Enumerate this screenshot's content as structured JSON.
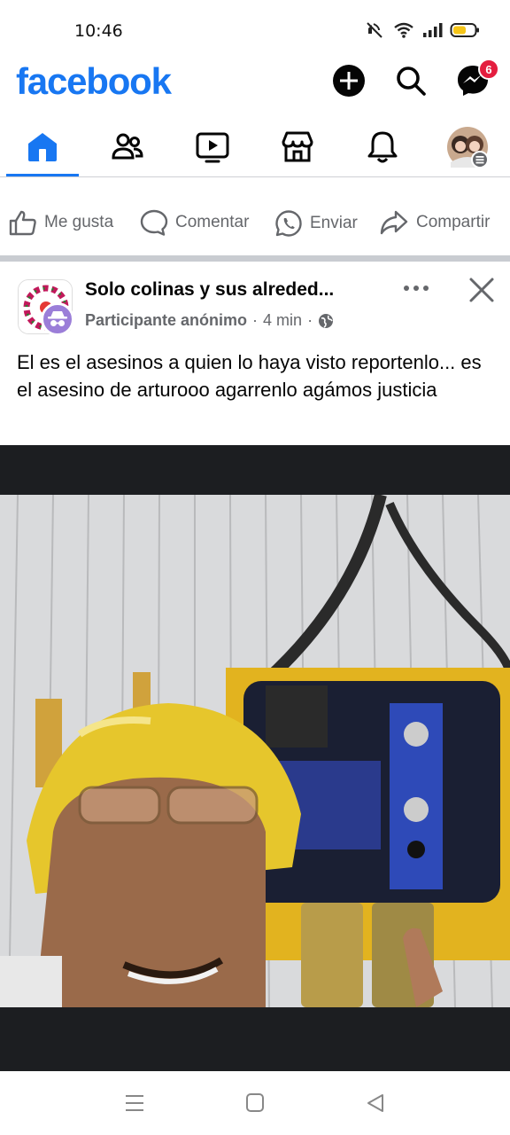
{
  "status_bar": {
    "time": "10:46",
    "icons": [
      "mute-icon",
      "wifi-icon",
      "signal-icon",
      "battery-icon"
    ]
  },
  "header": {
    "logo_text": "facebook",
    "brand_color": "#1877f2",
    "buttons": [
      "create-icon",
      "search-icon",
      "messenger-icon"
    ],
    "messenger_badge": "6"
  },
  "nav_tabs": [
    {
      "name": "home",
      "icon": "home-icon",
      "active": true
    },
    {
      "name": "friends",
      "icon": "friends-icon",
      "active": false
    },
    {
      "name": "video",
      "icon": "video-icon",
      "active": false
    },
    {
      "name": "marketplace",
      "icon": "marketplace-icon",
      "active": false
    },
    {
      "name": "notifications",
      "icon": "bell-icon",
      "active": false
    },
    {
      "name": "profile",
      "icon": "profile-avatar",
      "active": false
    }
  ],
  "previous_post_actions": {
    "like": "Me gusta",
    "comment": "Comentar",
    "send": "Enviar",
    "share": "Compartir"
  },
  "post": {
    "group_name": "Solo colinas y sus alreded...",
    "author": "Participante anónimo",
    "separator": "·",
    "time": "4 min",
    "separator2": "·",
    "privacy_icon": "globe-icon",
    "text": "El es el asesinos a quien  lo haya visto reportenlo... es el asesino de arturooo agarrenlo agámos justicia"
  },
  "system_nav": [
    "menu-icon",
    "home-square-icon",
    "back-icon"
  ]
}
